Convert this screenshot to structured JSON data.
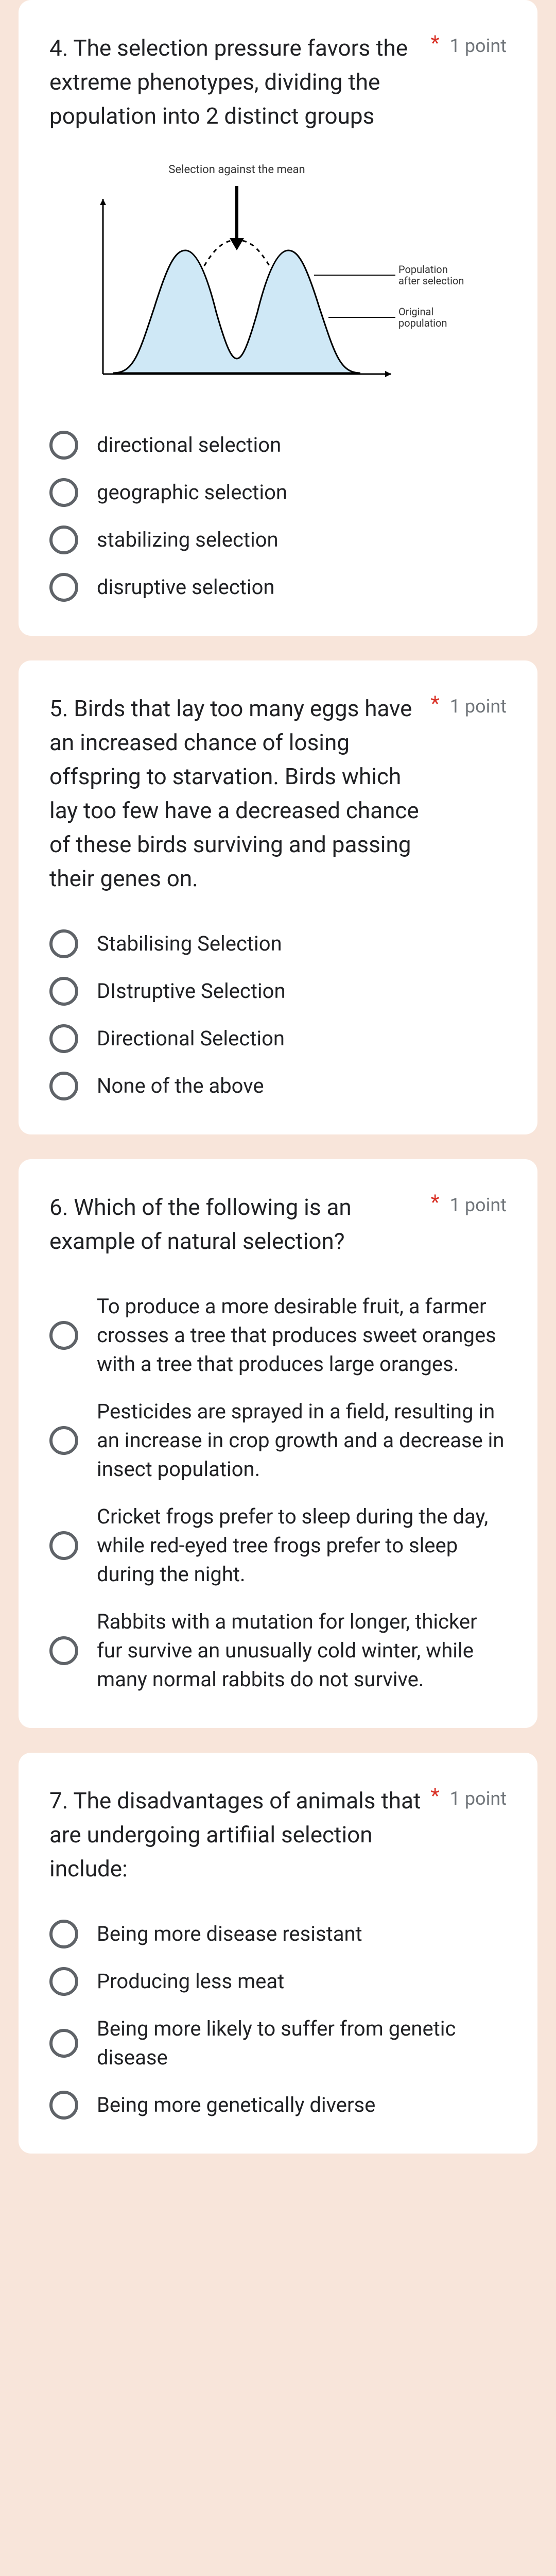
{
  "questions": [
    {
      "text": "4. The selection pressure favors the extreme phenotypes, dividing the population into 2 distinct groups",
      "required": "*",
      "points": "1 point",
      "chart": {
        "title": "Selection against the mean",
        "legend1": "Population after selection",
        "legend2": "Original population"
      },
      "options": [
        "directional selection",
        "geographic selection",
        "stabilizing selection",
        "disruptive selection"
      ]
    },
    {
      "text": "5. Birds that lay too many eggs have an increased chance of losing offspring to starvation. Birds which lay too few have a decreased chance of these birds surviving and passing their genes on.",
      "required": "*",
      "points": "1 point",
      "options": [
        "Stabilising Selection",
        "DIstruptive Selection",
        "Directional Selection",
        "None of the above"
      ]
    },
    {
      "text": "6. Which of the following is an example of natural selection?",
      "required": "*",
      "points": "1 point",
      "options": [
        "To produce a more desirable fruit, a farmer crosses a tree that produces sweet oranges with a tree that produces large oranges.",
        "Pesticides are sprayed in a field, resulting in an increase in crop growth and a decrease in insect population.",
        "Cricket frogs prefer to sleep during the day, while red-eyed tree frogs prefer to sleep during the night.",
        "Rabbits with a mutation for longer, thicker fur survive an unusually cold winter, while many normal rabbits do not survive."
      ]
    },
    {
      "text": "7. The disadvantages of animals that are undergoing artifiial selection include:",
      "required": "*",
      "points": "1 point",
      "options": [
        "Being more disease resistant",
        "Producing less meat",
        "Being more likely to suffer from genetic disease",
        "Being more genetically diverse"
      ]
    }
  ],
  "chart_data": {
    "type": "line",
    "title": "Selection against the mean",
    "xlabel": "",
    "ylabel": "",
    "series": [
      {
        "name": "Original population",
        "description": "normal bell curve centered on mean",
        "x": [
          0,
          1,
          2,
          3,
          4,
          5,
          6,
          7,
          8,
          9,
          10
        ],
        "y": [
          0,
          0.1,
          0.3,
          0.6,
          0.9,
          1.0,
          0.9,
          0.6,
          0.3,
          0.1,
          0
        ]
      },
      {
        "name": "Population after selection",
        "description": "bimodal distribution, two peaks either side of mean",
        "x": [
          0,
          1,
          2,
          3,
          4,
          5,
          6,
          7,
          8,
          9,
          10
        ],
        "y": [
          0,
          0.2,
          0.7,
          1.0,
          0.5,
          0.15,
          0.5,
          1.0,
          0.7,
          0.2,
          0
        ]
      }
    ],
    "annotation": "Selection against the mean (arrow pointing down at center)"
  }
}
